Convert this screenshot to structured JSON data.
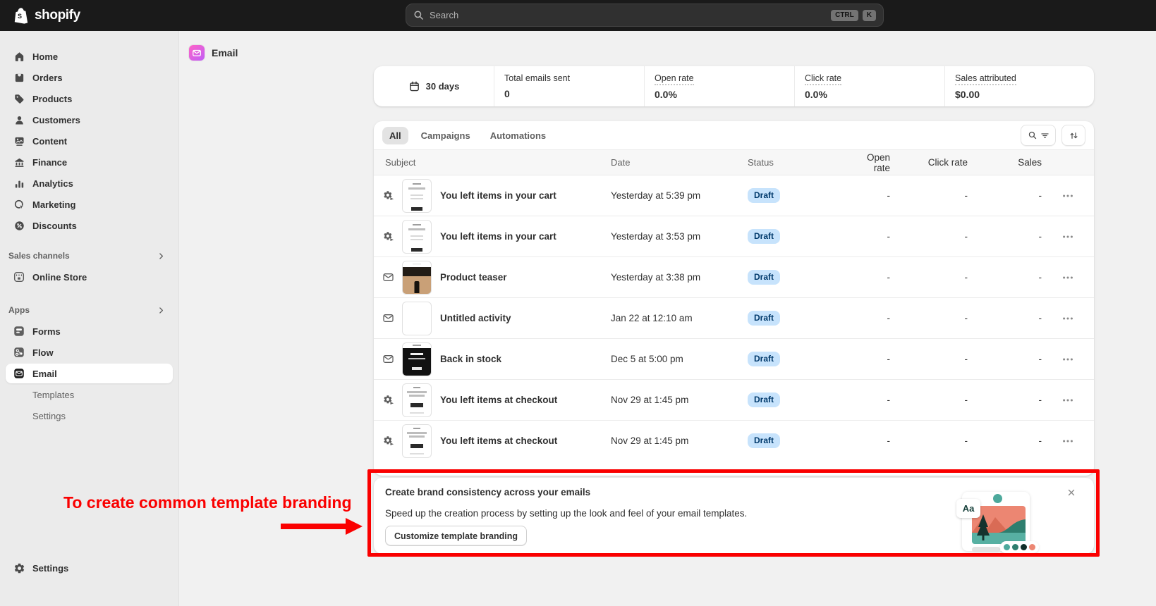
{
  "topbar": {
    "brand": "shopify",
    "search_placeholder": "Search",
    "shortcuts": [
      "CTRL",
      "K"
    ]
  },
  "sidebar": {
    "items": [
      {
        "label": "Home"
      },
      {
        "label": "Orders"
      },
      {
        "label": "Products"
      },
      {
        "label": "Customers"
      },
      {
        "label": "Content"
      },
      {
        "label": "Finance"
      },
      {
        "label": "Analytics"
      },
      {
        "label": "Marketing"
      },
      {
        "label": "Discounts"
      }
    ],
    "sales_channels_label": "Sales channels",
    "sales_channels": [
      {
        "label": "Online Store"
      }
    ],
    "apps_label": "Apps",
    "apps": [
      {
        "label": "Forms"
      },
      {
        "label": "Flow"
      },
      {
        "label": "Email",
        "selected": true
      }
    ],
    "email_children": [
      {
        "label": "Templates"
      },
      {
        "label": "Settings"
      }
    ],
    "footer": {
      "label": "Settings"
    }
  },
  "page": {
    "title": "Email"
  },
  "stats": {
    "period": "30 days",
    "metrics": [
      {
        "label": "Total emails sent",
        "value": "0"
      },
      {
        "label": "Open rate",
        "value": "0.0%"
      },
      {
        "label": "Click rate",
        "value": "0.0%"
      },
      {
        "label": "Sales attributed",
        "value": "$0.00"
      }
    ]
  },
  "tabs": {
    "items": [
      "All",
      "Campaigns",
      "Automations"
    ],
    "selected": "All"
  },
  "table": {
    "columns": [
      "Subject",
      "Date",
      "Status",
      "Open rate",
      "Click rate",
      "Sales"
    ],
    "rows": [
      {
        "type": "automation",
        "thumb": "cart",
        "subject": "You left items in your cart",
        "date": "Yesterday at 5:39 pm",
        "status": "Draft",
        "open_rate": "-",
        "click_rate": "-",
        "sales": "-"
      },
      {
        "type": "automation",
        "thumb": "cart",
        "subject": "You left items in your cart",
        "date": "Yesterday at 3:53 pm",
        "status": "Draft",
        "open_rate": "-",
        "click_rate": "-",
        "sales": "-"
      },
      {
        "type": "campaign",
        "thumb": "teaser",
        "subject": "Product teaser",
        "date": "Yesterday at 3:38 pm",
        "status": "Draft",
        "open_rate": "-",
        "click_rate": "-",
        "sales": "-"
      },
      {
        "type": "campaign",
        "thumb": "blank",
        "subject": "Untitled activity",
        "date": "Jan 22 at 12:10 am",
        "status": "Draft",
        "open_rate": "-",
        "click_rate": "-",
        "sales": "-"
      },
      {
        "type": "campaign",
        "thumb": "stock",
        "subject": "Back in stock",
        "date": "Dec 5 at 5:00 pm",
        "status": "Draft",
        "open_rate": "-",
        "click_rate": "-",
        "sales": "-"
      },
      {
        "type": "automation",
        "thumb": "checkout",
        "subject": "You left items at checkout",
        "date": "Nov 29 at 1:45 pm",
        "status": "Draft",
        "open_rate": "-",
        "click_rate": "-",
        "sales": "-"
      },
      {
        "type": "automation",
        "thumb": "checkout",
        "subject": "You left items at checkout",
        "date": "Nov 29 at 1:45 pm",
        "status": "Draft",
        "open_rate": "-",
        "click_rate": "-",
        "sales": "-"
      }
    ]
  },
  "banner": {
    "title": "Create brand consistency across your emails",
    "body": "Speed up the creation process by setting up the look and feel of your email templates.",
    "button": "Customize template branding",
    "illustration_text": "Aa"
  },
  "annotation": {
    "label": "To create common template branding",
    "color": "#fa0000"
  }
}
